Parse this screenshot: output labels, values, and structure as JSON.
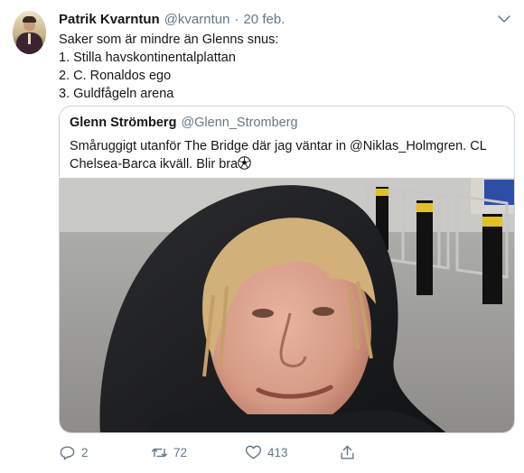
{
  "tweet": {
    "author_name": "Patrik Kvarntun",
    "author_handle": "@kvarntun",
    "separator": "·",
    "time": "20 feb.",
    "lines": [
      "Saker som är mindre än Glenns snus:",
      "1. Stilla havskontinentalplattan",
      "2. C. Ronaldos ego",
      "3. Guldfågeln arena"
    ]
  },
  "quoted": {
    "author_name": "Glenn Strömberg",
    "author_handle": "@Glenn_Stromberg",
    "text": "Småruggigt utanför The Bridge där jag väntar in @Niklas_Holmgren. CL Chelsea-Barca ikväll. Blir bra",
    "emoji_icon": "soccer-ball-icon"
  },
  "actions": {
    "reply_count": "2",
    "retweet_count": "72",
    "like_count": "413"
  },
  "colors": {
    "text": "#14171a",
    "secondary": "#657786",
    "border": "#ccd6dd"
  }
}
